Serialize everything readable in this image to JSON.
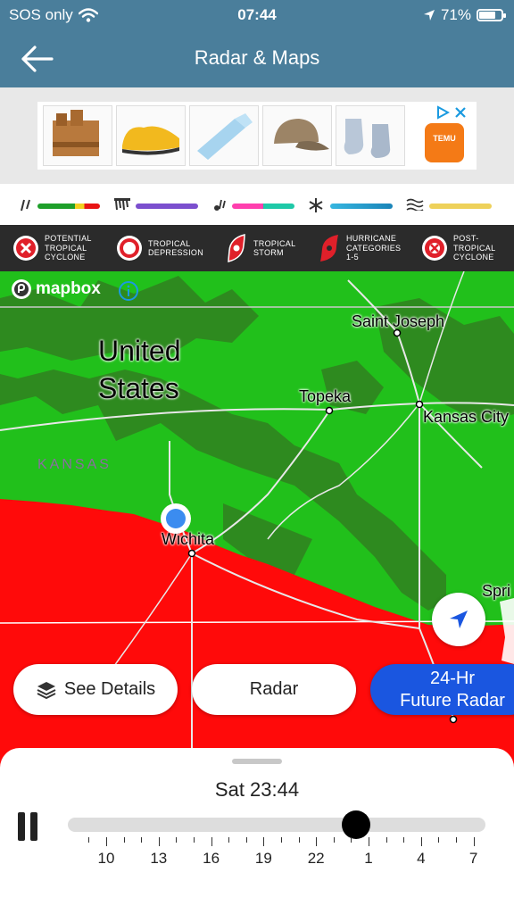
{
  "status_bar": {
    "carrier": "SOS only",
    "time": "07:44",
    "battery": "71%",
    "battery_level": 0.71
  },
  "header": {
    "title": "Radar & Maps"
  },
  "legend_icons": [
    "rain-icon",
    "ice-icon",
    "mix-icon",
    "snow-icon",
    "fog-icon"
  ],
  "storm_legend": [
    {
      "label": "POTENTIAL TROPICAL CYCLONE"
    },
    {
      "label": "TROPICAL DEPRESSION"
    },
    {
      "label": "TROPICAL STORM"
    },
    {
      "label": "HURRICANE CATEGORIES 1-5"
    },
    {
      "label": "POST-TROPICAL CYCLONE"
    }
  ],
  "ad": {
    "brand": "TEMU"
  },
  "map": {
    "attribution": "mapbox",
    "country": "United States",
    "state": "KANSAS",
    "cities": [
      "Saint Joseph",
      "Topeka",
      "Kansas City",
      "Wichita",
      "Spri"
    ]
  },
  "buttons": {
    "details": "See Details",
    "radar": "Radar",
    "future_line1": "24-Hr",
    "future_line2": "Future Radar"
  },
  "timeline": {
    "current": "Sat 23:44",
    "labels": [
      "10",
      "13",
      "16",
      "19",
      "22",
      "1",
      "4",
      "7"
    ],
    "position": 0.69
  },
  "colors": {
    "header": "#4a7e9b",
    "radar_green": "#21c01b",
    "radar_dark_green": "#2e8a1f",
    "radar_red": "#ff0a0a",
    "accent_blue": "#1a56e0"
  }
}
